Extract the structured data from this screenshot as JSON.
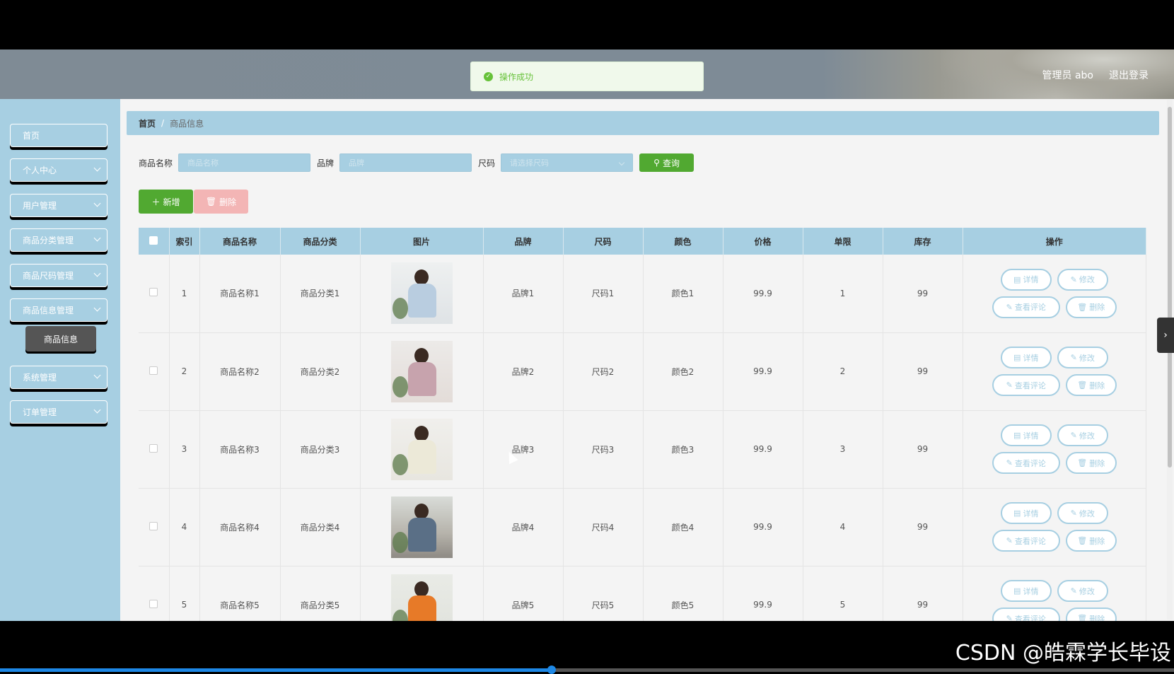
{
  "header": {
    "admin_label": "管理员 abo",
    "logout_label": "退出登录",
    "toast": "操作成功"
  },
  "sidebar": {
    "items": [
      {
        "label": "首页",
        "has_chevron": false
      },
      {
        "label": "个人中心",
        "has_chevron": true
      },
      {
        "label": "用户管理",
        "has_chevron": true
      },
      {
        "label": "商品分类管理",
        "has_chevron": true
      },
      {
        "label": "商品尺码管理",
        "has_chevron": true
      },
      {
        "label": "商品信息管理",
        "has_chevron": true
      },
      {
        "label": "系统管理",
        "has_chevron": true
      },
      {
        "label": "订单管理",
        "has_chevron": true
      }
    ],
    "sub_item": "商品信息"
  },
  "breadcrumb": {
    "home": "首页",
    "separator": "/",
    "current": "商品信息"
  },
  "search": {
    "name_label": "商品名称",
    "name_placeholder": "商品名称",
    "brand_label": "品牌",
    "brand_placeholder": "品牌",
    "size_label": "尺码",
    "size_placeholder": "请选择尺码",
    "query_label": "查询"
  },
  "actions": {
    "add_label": "新增",
    "delete_label": "删除"
  },
  "table": {
    "headers": [
      "索引",
      "商品名称",
      "商品分类",
      "图片",
      "品牌",
      "尺码",
      "颜色",
      "价格",
      "单限",
      "库存",
      "操作"
    ],
    "rows": [
      {
        "index": "1",
        "name": "商品名称1",
        "category": "商品分类1",
        "brand": "品牌1",
        "size": "尺码1",
        "color": "颜色1",
        "price": "99.9",
        "limit": "1",
        "stock": "99"
      },
      {
        "index": "2",
        "name": "商品名称2",
        "category": "商品分类2",
        "brand": "品牌2",
        "size": "尺码2",
        "color": "颜色2",
        "price": "99.9",
        "limit": "2",
        "stock": "99"
      },
      {
        "index": "3",
        "name": "商品名称3",
        "category": "商品分类3",
        "brand": "品牌3",
        "size": "尺码3",
        "color": "颜色3",
        "price": "99.9",
        "limit": "3",
        "stock": "99"
      },
      {
        "index": "4",
        "name": "商品名称4",
        "category": "商品分类4",
        "brand": "品牌4",
        "size": "尺码4",
        "color": "颜色4",
        "price": "99.9",
        "limit": "4",
        "stock": "99"
      },
      {
        "index": "5",
        "name": "商品名称5",
        "category": "商品分类5",
        "brand": "品牌5",
        "size": "尺码5",
        "color": "颜色5",
        "price": "99.9",
        "limit": "5",
        "stock": "99"
      }
    ],
    "ops": {
      "detail": "详情",
      "edit": "修改",
      "comments": "查看评论",
      "delete": "删除"
    }
  },
  "watermark": "CSDN @皓霖学长毕设",
  "video_progress": 0.47,
  "colors": {
    "accent": "#a7cfe2",
    "success": "#51a931",
    "danger": "#f3b5b5"
  }
}
